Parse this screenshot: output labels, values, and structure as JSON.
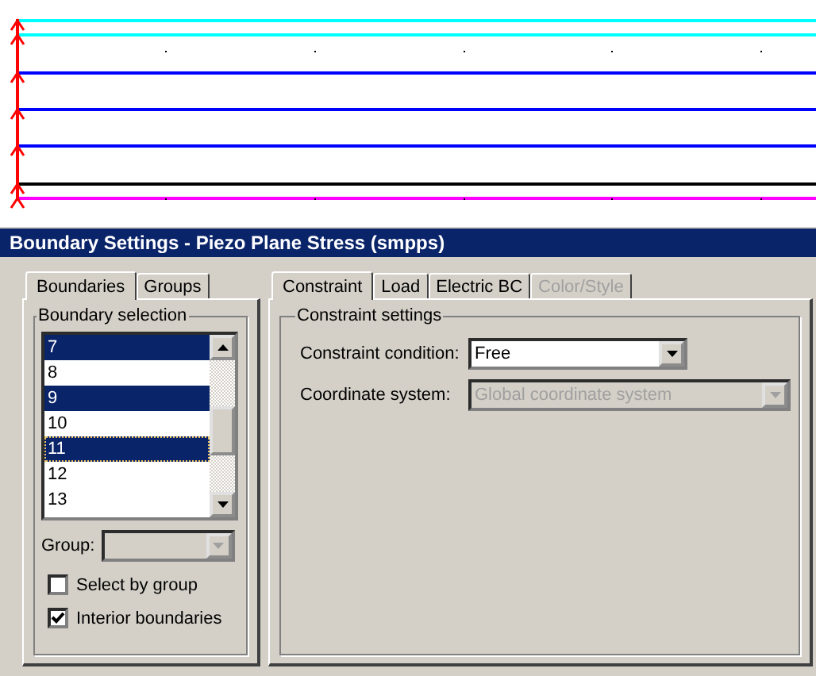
{
  "canvas": {
    "lines": [
      {
        "color": "#00ffff"
      },
      {
        "color": "#00ffff"
      },
      {
        "color": "#0000ff"
      },
      {
        "color": "#0000ff"
      },
      {
        "color": "#0000ff"
      },
      {
        "color": "#000000"
      },
      {
        "color": "#ff00ff"
      }
    ]
  },
  "dialog": {
    "title": "Boundary Settings - Piezo Plane Stress (smpps)",
    "left_tabs": [
      {
        "label": "Boundaries",
        "selected": true
      },
      {
        "label": "Groups",
        "selected": false
      }
    ],
    "boundary_selection": {
      "title": "Boundary selection",
      "items": [
        {
          "label": "7",
          "selected": true,
          "focused": false
        },
        {
          "label": "8",
          "selected": false,
          "focused": false
        },
        {
          "label": "9",
          "selected": true,
          "focused": false
        },
        {
          "label": "10",
          "selected": false,
          "focused": false
        },
        {
          "label": "11",
          "selected": true,
          "focused": true
        },
        {
          "label": "12",
          "selected": false,
          "focused": false
        },
        {
          "label": "13",
          "selected": false,
          "focused": false
        }
      ],
      "group": {
        "label": "Group:",
        "disabled": true
      },
      "checkboxes": [
        {
          "label": "Select by group",
          "checked": false
        },
        {
          "label": "Interior boundaries",
          "checked": true
        }
      ]
    },
    "right_tabs": [
      {
        "label": "Constraint",
        "selected": true,
        "disabled": false
      },
      {
        "label": "Load",
        "selected": false,
        "disabled": false
      },
      {
        "label": "Electric BC",
        "selected": false,
        "disabled": false
      },
      {
        "label": "Color/Style",
        "selected": false,
        "disabled": true
      }
    ],
    "constraint_settings": {
      "title": "Constraint settings",
      "fields": [
        {
          "label": "Constraint condition:",
          "value": "Free",
          "disabled": false
        },
        {
          "label": "Coordinate system:",
          "value": "Global coordinate system",
          "disabled": true
        }
      ]
    }
  }
}
